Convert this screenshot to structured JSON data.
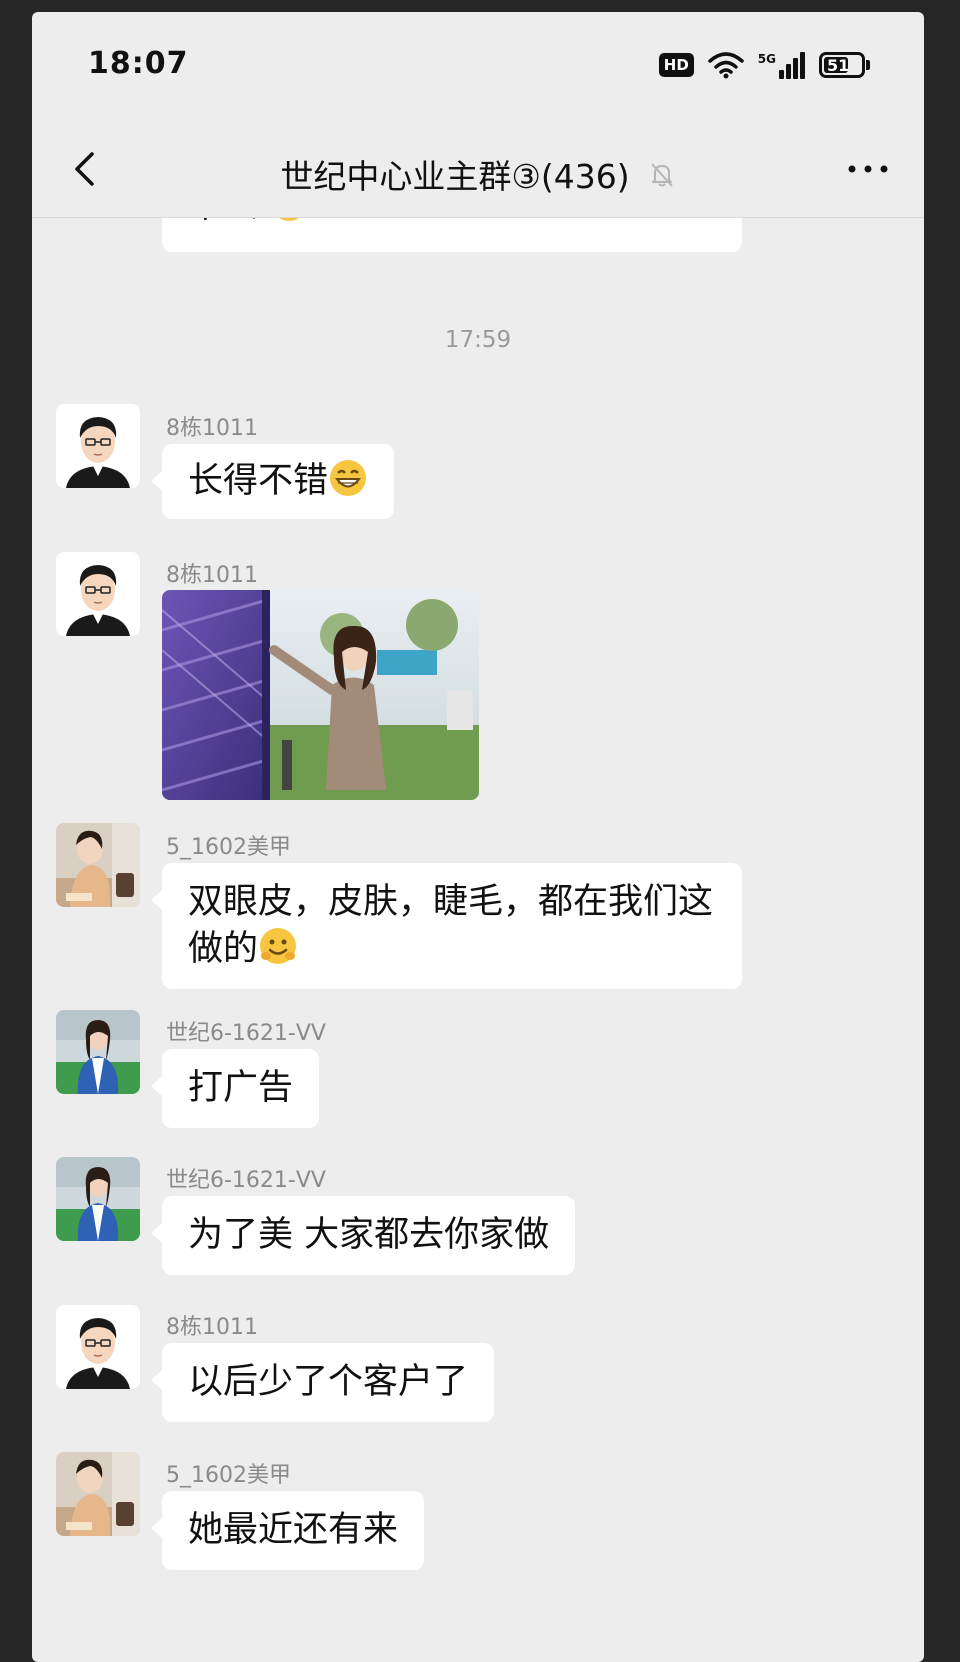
{
  "status_bar": {
    "time": "18:07",
    "hd_label": "HD",
    "network_label": "5G",
    "battery_level": "51"
  },
  "header": {
    "title": "世纪中心业主群③(436)",
    "back_icon": "chevron-left-icon",
    "mute_icon": "bell-off-icon",
    "more_icon": "more-horizontal-icon"
  },
  "chat": {
    "partial_message": "早么",
    "timestamp": "17:59",
    "messages": [
      {
        "sender": "8栋1011",
        "text": "长得不错",
        "emoji": "grinning-face-icon"
      },
      {
        "sender": "8栋1011",
        "type": "image"
      },
      {
        "sender": "5_1602美甲",
        "text_line1": "双眼皮，皮肤，睫毛，都在我们这",
        "text_line2": "做的",
        "emoji": "smiling-face-icon"
      },
      {
        "sender": "世纪6-1621-VV",
        "text": "打广告"
      },
      {
        "sender": "世纪6-1621-VV",
        "text": "为了美 大家都去你家做"
      },
      {
        "sender": "8栋1011",
        "text": "以后少了个客户了"
      },
      {
        "sender": "5_1602美甲",
        "text": "她最近还有来"
      }
    ]
  },
  "colors": {
    "background": "#ededed",
    "bubble": "#ffffff",
    "sender_text": "#8a8a8a",
    "frame": "#262626"
  }
}
